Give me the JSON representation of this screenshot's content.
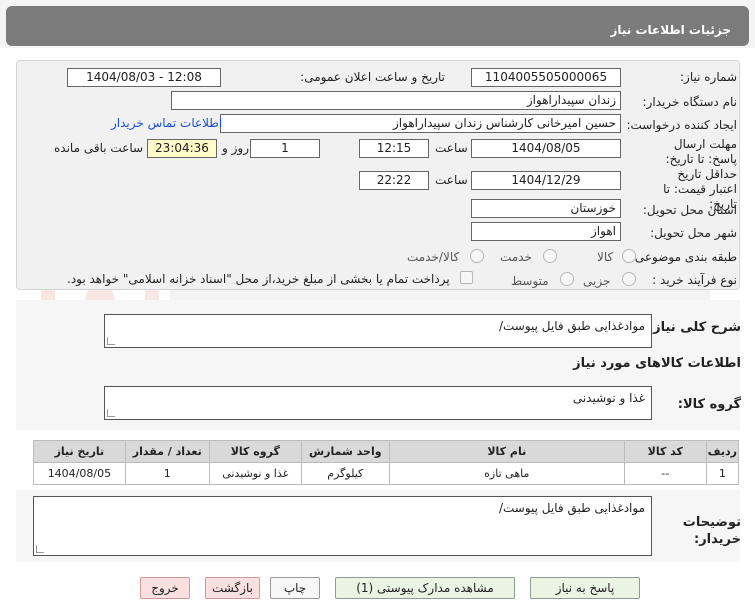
{
  "header": {
    "title": "جزئیات اطلاعات نیاز"
  },
  "form": {
    "need_number_label": "شماره نیاز:",
    "need_number": "1104005505000065",
    "announce_label": "تاریخ و ساعت اعلان عمومی:",
    "announce_value": "1404/08/03 - 12:08",
    "buyer_org_label": "نام دستگاه خریدار:",
    "buyer_org": "زندان سپیداراهواز",
    "creator_label": "ایجاد کننده درخواست:",
    "creator": "حسین امیرخانی کارشناس زندان سپیداراهواز",
    "contact_link": "اطلاعات تماس خریدار",
    "reply_deadline_label": "مهلت ارسال پاسخ: تا تاریخ:",
    "reply_date": "1404/08/05",
    "time_label": "ساعت",
    "reply_time": "12:15",
    "days_value": "1",
    "days_label": "روز و",
    "remaining_time": "23:04:36",
    "remaining_label": "ساعت باقی مانده",
    "validity_label": "حداقل تاریخ اعتبار قیمت: تا تاریخ:",
    "validity_date": "1404/12/29",
    "validity_time": "22:22",
    "province_label": "استان محل تحویل:",
    "province": "خوزستان",
    "city_label": "شهر محل تحویل:",
    "city": "اهواز",
    "category_label": "طبقه بندی موضوعی:",
    "category_options": [
      "کالا",
      "خدمت",
      "کالا/خدمت"
    ],
    "process_label": "نوع فرآیند خرید :",
    "process_options": [
      "جزیی",
      "متوسط"
    ],
    "payment_note": "پرداخت تمام یا بخشی از مبلغ خرید،از محل \"اسناد خزانه اسلامی\" خواهد بود."
  },
  "general_desc": {
    "label": "شرح کلی نیاز:",
    "value": "موادغذایی طبق فایل پیوست/"
  },
  "goods_info": {
    "title": "اطلاعات کالاهای مورد نیاز",
    "group_label": "گروه کالا:",
    "group_value": "غذا و نوشیدنی"
  },
  "table": {
    "headers": [
      "ردیف",
      "کد کالا",
      "نام کالا",
      "واحد شمارش",
      "گروه کالا",
      "تعداد / مقدار",
      "تاریخ نیاز"
    ],
    "rows": [
      [
        "1",
        "--",
        "ماهی تازه",
        "کیلوگرم",
        "غذا و نوشیدنی",
        "1",
        "1404/08/05"
      ]
    ]
  },
  "buyer_desc": {
    "label": "توضیحات خریدار:",
    "value": "موادغذایی طبق فایل پیوست/"
  },
  "buttons": {
    "reply": "پاسخ به نیاز",
    "attachments": "مشاهده مدارک پیوستی (1)",
    "print": "چاپ",
    "back": "بازگشت",
    "exit": "خروج"
  }
}
